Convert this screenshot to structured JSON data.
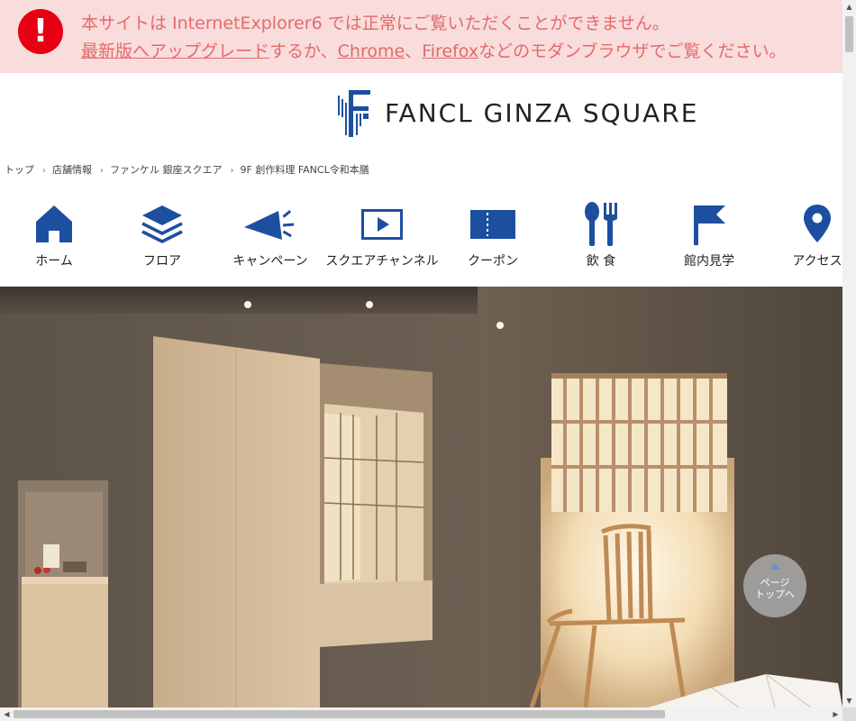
{
  "banner": {
    "line1": "本サイトは InternetExplorer6 では正常にご覧いただくことができません。",
    "upgrade_link": "最新版へアップグレード",
    "text_a": "するか、",
    "chrome_link": "Chrome",
    "text_b": "、",
    "firefox_link": "Firefox",
    "text_c": "などのモダンブラウザでご覧ください。",
    "icon": "exclamation-icon"
  },
  "header": {
    "logo_text": "FANCL GINZA SQUARE"
  },
  "breadcrumb": [
    "トップ",
    "店舗情報",
    "ファンケル 銀座スクエア",
    "9F 創作料理 FANCL令和本膳"
  ],
  "nav": [
    {
      "label": "ホーム",
      "icon": "home-icon"
    },
    {
      "label": "フロア",
      "icon": "layers-icon"
    },
    {
      "label": "キャンペーン",
      "icon": "megaphone-icon"
    },
    {
      "label": "スクエアチャンネル",
      "icon": "play-icon"
    },
    {
      "label": "クーポン",
      "icon": "coupon-icon"
    },
    {
      "label": "飲 食",
      "icon": "cutlery-icon"
    },
    {
      "label": "館内見学",
      "icon": "flag-icon"
    },
    {
      "label": "アクセス",
      "icon": "map-pin-icon"
    }
  ],
  "pagetop": {
    "label_1": "ページ",
    "label_2": "トップへ"
  },
  "colors": {
    "brand_blue": "#1d4fa0",
    "banner_bg": "#f9dcdc",
    "banner_text": "#e46a6a",
    "alert_red": "#e60012"
  }
}
